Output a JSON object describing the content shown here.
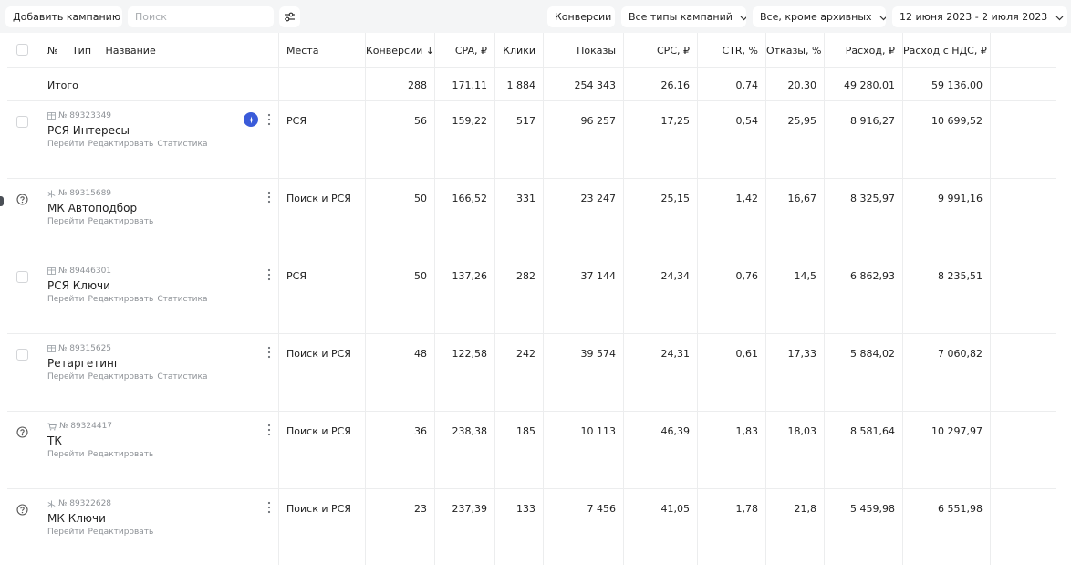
{
  "toolbar": {
    "add_campaign": "Добавить кампанию",
    "search_placeholder": "Поиск",
    "conversions_btn": "Конверсии",
    "campaign_types": "Все типы кампаний",
    "status_filter": "Все, кроме архивных",
    "date_range": "12 июня 2023 - 2 июля 2023"
  },
  "header": {
    "num": "№",
    "type": "Тип",
    "name": "Название",
    "places": "Места",
    "conversions": "Конверсии ↓",
    "cpa": "CPA, ₽",
    "clicks": "Клики",
    "shows": "Показы",
    "cpc": "CPC, ₽",
    "ctr": "CTR, %",
    "bounces": "Отказы, %",
    "cost": "Расход, ₽",
    "cost_vat": "Расход с НДС, ₽"
  },
  "total": {
    "label": "Итого",
    "conversions": "288",
    "cpa": "171,11",
    "clicks": "1 884",
    "shows": "254 343",
    "cpc": "26,16",
    "ctr": "0,74",
    "bounces": "20,30",
    "cost": "49 280,01",
    "cost_vat": "59 136,00"
  },
  "link_labels": {
    "go": "Перейти",
    "edit": "Редактировать",
    "stats": "Статистика"
  },
  "rows": [
    {
      "id": "№ 89323349",
      "type_icon": "network-grid-icon",
      "title": "РСЯ Интересы",
      "places": "РСЯ",
      "conversions": "56",
      "cpa": "159,22",
      "clicks": "517",
      "shows": "96 257",
      "cpc": "17,25",
      "ctr": "0,54",
      "bounces": "25,95",
      "cost": "8 916,27",
      "cost_vat": "10 699,52",
      "status": "checkbox",
      "has_stats": true,
      "has_badge": true
    },
    {
      "id": "№ 89315689",
      "type_icon": "master-campaign-icon",
      "title": "МК Автоподбор",
      "places": "Поиск и РСЯ",
      "conversions": "50",
      "cpa": "166,52",
      "clicks": "331",
      "shows": "23 247",
      "cpc": "25,15",
      "ctr": "1,42",
      "bounces": "16,67",
      "cost": "8 325,97",
      "cost_vat": "9 991,16",
      "status": "help",
      "has_stats": false,
      "has_badge": false
    },
    {
      "id": "№ 89446301",
      "type_icon": "network-grid-icon",
      "title": "РСЯ Ключи",
      "places": "РСЯ",
      "conversions": "50",
      "cpa": "137,26",
      "clicks": "282",
      "shows": "37 144",
      "cpc": "24,34",
      "ctr": "0,76",
      "bounces": "14,5",
      "cost": "6 862,93",
      "cost_vat": "8 235,51",
      "status": "checkbox",
      "has_stats": true,
      "has_badge": false
    },
    {
      "id": "№ 89315625",
      "type_icon": "network-grid-icon",
      "title": "Ретаргетинг",
      "places": "Поиск и РСЯ",
      "conversions": "48",
      "cpa": "122,58",
      "clicks": "242",
      "shows": "39 574",
      "cpc": "24,31",
      "ctr": "0,61",
      "bounces": "17,33",
      "cost": "5 884,02",
      "cost_vat": "7 060,82",
      "status": "checkbox",
      "has_stats": true,
      "has_badge": false
    },
    {
      "id": "№ 89324417",
      "type_icon": "cart-icon",
      "title": "ТК",
      "places": "Поиск и РСЯ",
      "conversions": "36",
      "cpa": "238,38",
      "clicks": "185",
      "shows": "10 113",
      "cpc": "46,39",
      "ctr": "1,83",
      "bounces": "18,03",
      "cost": "8 581,64",
      "cost_vat": "10 297,97",
      "status": "help",
      "has_stats": false,
      "has_badge": false
    },
    {
      "id": "№ 89322628",
      "type_icon": "master-campaign-icon",
      "title": "МК Ключи",
      "places": "Поиск и РСЯ",
      "conversions": "23",
      "cpa": "237,39",
      "clicks": "133",
      "shows": "7 456",
      "cpc": "41,05",
      "ctr": "1,78",
      "bounces": "21,8",
      "cost": "5 459,98",
      "cost_vat": "6 551,98",
      "status": "help",
      "has_stats": false,
      "has_badge": false
    }
  ]
}
